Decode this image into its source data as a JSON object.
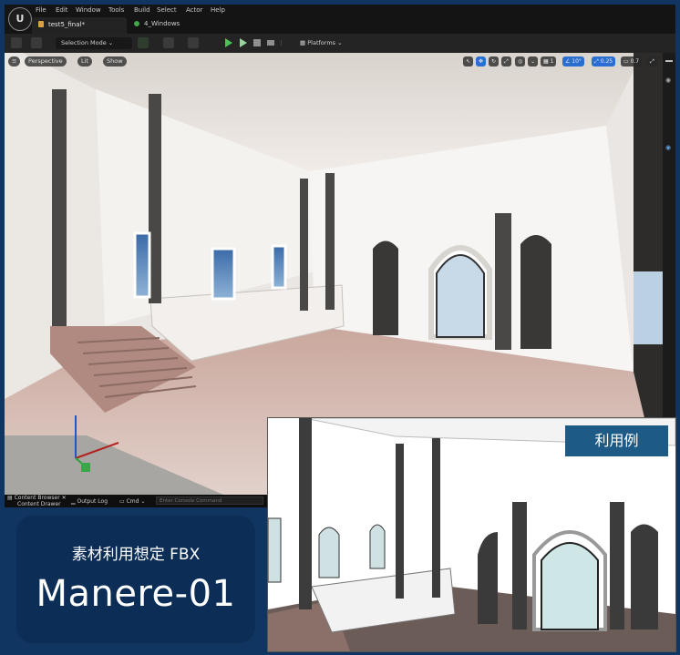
{
  "menubar": {
    "items": [
      "File",
      "Edit",
      "Window",
      "Tools",
      "Build",
      "Select",
      "Actor",
      "Help"
    ],
    "tabs": [
      {
        "label": "test5_final*"
      },
      {
        "label": "4_Windows"
      }
    ]
  },
  "toolbar": {
    "selection_mode": "Selection Mode",
    "platforms": "Platforms"
  },
  "viewport": {
    "perspective": "Perspective",
    "lit": "Lit",
    "show": "Show",
    "grid_value": "1",
    "angle_value": "10°",
    "scale_value": "0.25",
    "camera_speed": "0.7"
  },
  "statusbar": {
    "content_browser": "Content Browser",
    "content_drawer": "Content Drawer",
    "output_log": "Output Log",
    "cmd": "Cmd",
    "console_placeholder": "Enter Console Command"
  },
  "promo": {
    "subtitle": "素材利用想定 FBX",
    "title": "Manere-01"
  },
  "inset": {
    "badge": "利用例"
  },
  "colors": {
    "background": "#0f3560",
    "card": "#0c2d56",
    "badge": "#1d5a86"
  }
}
